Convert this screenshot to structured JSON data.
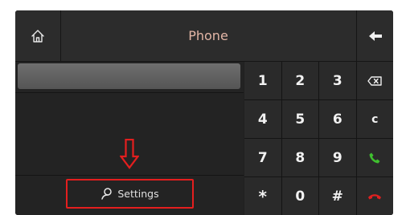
{
  "header": {
    "title": "Phone",
    "home_icon": "home-icon",
    "back_icon": "back-arrow-icon"
  },
  "left_panel": {
    "number_display_value": "",
    "pointer_icon": "down-arrow-icon",
    "settings": {
      "label": "Settings",
      "icon": "person-icon"
    }
  },
  "keypad": {
    "keys": [
      "1",
      "2",
      "3",
      "⌫",
      "4",
      "5",
      "6",
      "c",
      "7",
      "8",
      "9",
      "call",
      "*",
      "0",
      "#",
      "hangup"
    ]
  },
  "colors": {
    "title": "#e2b5a6",
    "highlight": "#e41e1e",
    "call": "#3fbf2f",
    "hangup": "#e02020"
  }
}
